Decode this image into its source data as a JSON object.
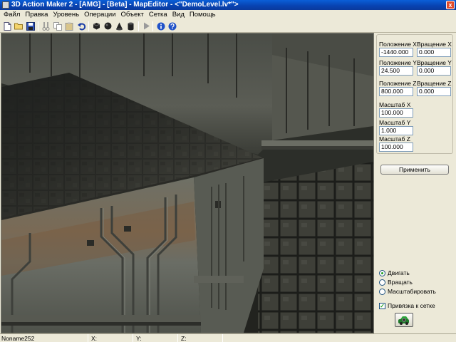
{
  "window": {
    "title": "3D Action Maker 2 - [AMG] - [Beta] - MapEditor - <\"DemoLevel.lv*\">",
    "close_glyph": "x"
  },
  "menu": [
    "Файл",
    "Правка",
    "Уровень",
    "Операции",
    "Объект",
    "Сетка",
    "Вид",
    "Помощь"
  ],
  "toolbar": {
    "icons": [
      "new-file-icon",
      "open-folder-icon",
      "save-icon",
      "cut-icon",
      "copy-icon",
      "paste-icon",
      "undo-icon",
      "cube-icon",
      "sphere-icon",
      "cone-icon",
      "cylinder-icon",
      "play-icon",
      "info-icon",
      "help-icon"
    ]
  },
  "properties": {
    "pos_x_label": "Положение X",
    "rot_x_label": "Вращение X",
    "pos_x": "-1440.000",
    "rot_x": "0.000",
    "pos_y_label": "Положение Y",
    "rot_y_label": "Вращение Y",
    "pos_y": "24.500",
    "rot_y": "0.000",
    "pos_z_label": "Положение Z",
    "rot_z_label": "Вращение Z",
    "pos_z": "800.000",
    "rot_z": "0.000",
    "scale_x_label": "Масштаб X",
    "scale_x": "100.000",
    "scale_y_label": "Масштаб Y",
    "scale_y": "1.000",
    "scale_z_label": "Масштаб Z",
    "scale_z": "100.000",
    "apply_label": "Применить"
  },
  "modes": {
    "move_label": "Двигать",
    "rotate_label": "Вращать",
    "scale_label": "Масштабировать",
    "selected": "move"
  },
  "snap": {
    "label": "Привязка к сетке",
    "checked": true
  },
  "status": {
    "object_name": "Noname252",
    "x_label": "X:",
    "y_label": "Y:",
    "z_label": "Z:"
  },
  "colors": {
    "title_bar": "#0842b0",
    "accent_green": "#21a121"
  }
}
